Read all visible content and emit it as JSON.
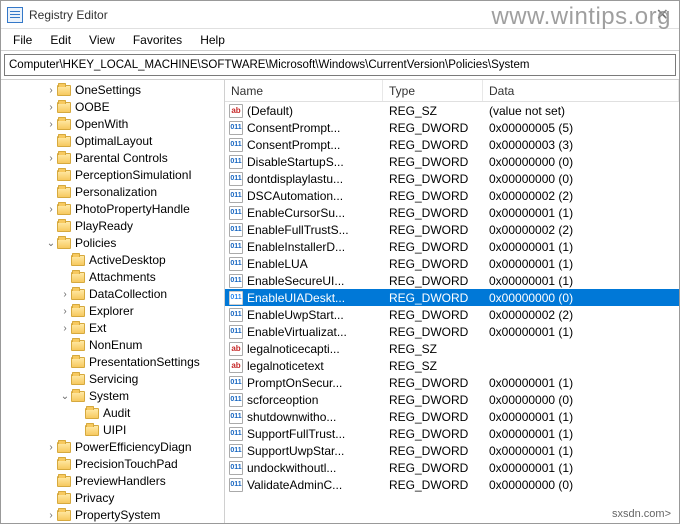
{
  "window": {
    "title": "Registry Editor",
    "close_glyph": "✕"
  },
  "watermark": "www.wintips.org",
  "source_tag": "sxsdn.com>",
  "menubar": [
    "File",
    "Edit",
    "View",
    "Favorites",
    "Help"
  ],
  "addressbar": "Computer\\HKEY_LOCAL_MACHINE\\SOFTWARE\\Microsoft\\Windows\\CurrentVersion\\Policies\\System",
  "tree": [
    {
      "indent": 3,
      "twisty": ">",
      "label": "OneSettings"
    },
    {
      "indent": 3,
      "twisty": ">",
      "label": "OOBE"
    },
    {
      "indent": 3,
      "twisty": ">",
      "label": "OpenWith"
    },
    {
      "indent": 3,
      "twisty": "",
      "label": "OptimalLayout"
    },
    {
      "indent": 3,
      "twisty": ">",
      "label": "Parental Controls"
    },
    {
      "indent": 3,
      "twisty": "",
      "label": "PerceptionSimulationI"
    },
    {
      "indent": 3,
      "twisty": "",
      "label": "Personalization"
    },
    {
      "indent": 3,
      "twisty": ">",
      "label": "PhotoPropertyHandle"
    },
    {
      "indent": 3,
      "twisty": "",
      "label": "PlayReady"
    },
    {
      "indent": 3,
      "twisty": "v",
      "label": "Policies"
    },
    {
      "indent": 4,
      "twisty": "",
      "label": "ActiveDesktop"
    },
    {
      "indent": 4,
      "twisty": "",
      "label": "Attachments"
    },
    {
      "indent": 4,
      "twisty": ">",
      "label": "DataCollection"
    },
    {
      "indent": 4,
      "twisty": ">",
      "label": "Explorer"
    },
    {
      "indent": 4,
      "twisty": ">",
      "label": "Ext"
    },
    {
      "indent": 4,
      "twisty": "",
      "label": "NonEnum"
    },
    {
      "indent": 4,
      "twisty": "",
      "label": "PresentationSettings"
    },
    {
      "indent": 4,
      "twisty": "",
      "label": "Servicing"
    },
    {
      "indent": 4,
      "twisty": "v",
      "label": "System"
    },
    {
      "indent": 5,
      "twisty": "",
      "label": "Audit"
    },
    {
      "indent": 5,
      "twisty": "",
      "label": "UIPI"
    },
    {
      "indent": 3,
      "twisty": ">",
      "label": "PowerEfficiencyDiagn"
    },
    {
      "indent": 3,
      "twisty": "",
      "label": "PrecisionTouchPad"
    },
    {
      "indent": 3,
      "twisty": "",
      "label": "PreviewHandlers"
    },
    {
      "indent": 3,
      "twisty": "",
      "label": "Privacy"
    },
    {
      "indent": 3,
      "twisty": ">",
      "label": "PropertySystem"
    }
  ],
  "list": {
    "columns": {
      "name": "Name",
      "type": "Type",
      "data": "Data"
    },
    "rows": [
      {
        "icon": "sz",
        "name": "(Default)",
        "type": "REG_SZ",
        "data": "(value not set)"
      },
      {
        "icon": "dw",
        "name": "ConsentPrompt...",
        "type": "REG_DWORD",
        "data": "0x00000005 (5)"
      },
      {
        "icon": "dw",
        "name": "ConsentPrompt...",
        "type": "REG_DWORD",
        "data": "0x00000003 (3)"
      },
      {
        "icon": "dw",
        "name": "DisableStartupS...",
        "type": "REG_DWORD",
        "data": "0x00000000 (0)"
      },
      {
        "icon": "dw",
        "name": "dontdisplaylastu...",
        "type": "REG_DWORD",
        "data": "0x00000000 (0)"
      },
      {
        "icon": "dw",
        "name": "DSCAutomation...",
        "type": "REG_DWORD",
        "data": "0x00000002 (2)"
      },
      {
        "icon": "dw",
        "name": "EnableCursorSu...",
        "type": "REG_DWORD",
        "data": "0x00000001 (1)"
      },
      {
        "icon": "dw",
        "name": "EnableFullTrustS...",
        "type": "REG_DWORD",
        "data": "0x00000002 (2)"
      },
      {
        "icon": "dw",
        "name": "EnableInstallerD...",
        "type": "REG_DWORD",
        "data": "0x00000001 (1)"
      },
      {
        "icon": "dw",
        "name": "EnableLUA",
        "type": "REG_DWORD",
        "data": "0x00000001 (1)"
      },
      {
        "icon": "dw",
        "name": "EnableSecureUI...",
        "type": "REG_DWORD",
        "data": "0x00000001 (1)"
      },
      {
        "icon": "dw",
        "name": "EnableUIADeskt...",
        "type": "REG_DWORD",
        "data": "0x00000000 (0)",
        "selected": true
      },
      {
        "icon": "dw",
        "name": "EnableUwpStart...",
        "type": "REG_DWORD",
        "data": "0x00000002 (2)"
      },
      {
        "icon": "dw",
        "name": "EnableVirtualizat...",
        "type": "REG_DWORD",
        "data": "0x00000001 (1)"
      },
      {
        "icon": "sz",
        "name": "legalnoticecapti...",
        "type": "REG_SZ",
        "data": ""
      },
      {
        "icon": "sz",
        "name": "legalnoticetext",
        "type": "REG_SZ",
        "data": ""
      },
      {
        "icon": "dw",
        "name": "PromptOnSecur...",
        "type": "REG_DWORD",
        "data": "0x00000001 (1)"
      },
      {
        "icon": "dw",
        "name": "scforceoption",
        "type": "REG_DWORD",
        "data": "0x00000000 (0)"
      },
      {
        "icon": "dw",
        "name": "shutdownwitho...",
        "type": "REG_DWORD",
        "data": "0x00000001 (1)"
      },
      {
        "icon": "dw",
        "name": "SupportFullTrust...",
        "type": "REG_DWORD",
        "data": "0x00000001 (1)"
      },
      {
        "icon": "dw",
        "name": "SupportUwpStar...",
        "type": "REG_DWORD",
        "data": "0x00000001 (1)"
      },
      {
        "icon": "dw",
        "name": "undockwithoutl...",
        "type": "REG_DWORD",
        "data": "0x00000001 (1)"
      },
      {
        "icon": "dw",
        "name": "ValidateAdminC...",
        "type": "REG_DWORD",
        "data": "0x00000000 (0)"
      }
    ]
  }
}
